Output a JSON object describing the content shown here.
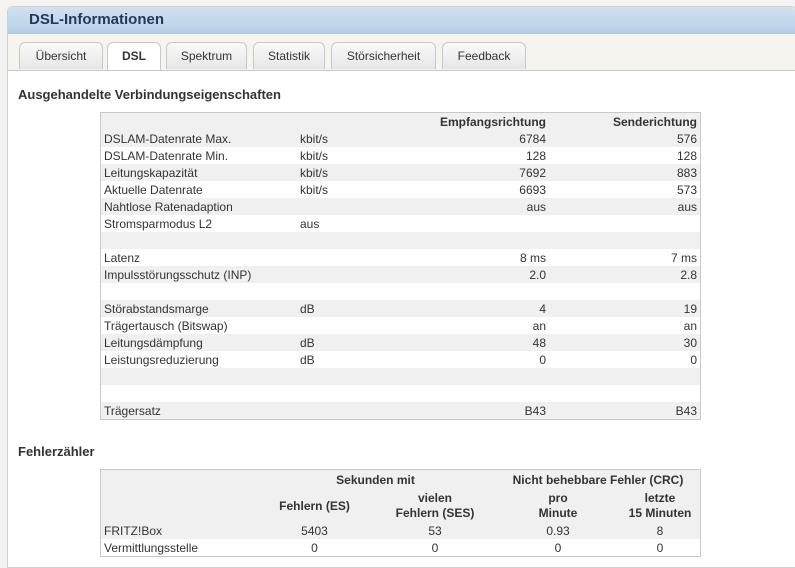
{
  "title": "DSL-Informationen",
  "tabs": [
    "Übersicht",
    "DSL",
    "Spektrum",
    "Statistik",
    "Störsicherheit",
    "Feedback"
  ],
  "active_tab": "DSL",
  "section1": {
    "heading": "Ausgehandelte Verbindungseigenschaften",
    "col_down": "Empfangsrichtung",
    "col_up": "Senderichtung",
    "rows": [
      {
        "label": "DSLAM-Datenrate Max.",
        "unit": "kbit/s",
        "down": "6784",
        "up": "576"
      },
      {
        "label": "DSLAM-Datenrate Min.",
        "unit": "kbit/s",
        "down": "128",
        "up": "128"
      },
      {
        "label": "Leitungskapazität",
        "unit": "kbit/s",
        "down": "7692",
        "up": "883"
      },
      {
        "label": "Aktuelle Datenrate",
        "unit": "kbit/s",
        "down": "6693",
        "up": "573"
      },
      {
        "label": "Nahtlose Ratenadaption",
        "unit": "",
        "down": "aus",
        "up": "aus"
      },
      {
        "label": "Stromsparmodus L2",
        "unit": "aus",
        "down": "",
        "up": ""
      },
      {
        "label": "",
        "unit": "",
        "down": "",
        "up": ""
      },
      {
        "label": "Latenz",
        "unit": "",
        "down": "8 ms",
        "up": "7 ms"
      },
      {
        "label": "Impulsstörungsschutz (INP)",
        "unit": "",
        "down": "2.0",
        "up": "2.8"
      },
      {
        "label": "",
        "unit": "",
        "down": "",
        "up": ""
      },
      {
        "label": "Störabstandsmarge",
        "unit": "dB",
        "down": "4",
        "up": "19"
      },
      {
        "label": "Trägertausch (Bitswap)",
        "unit": "",
        "down": "an",
        "up": "an"
      },
      {
        "label": "Leitungsdämpfung",
        "unit": "dB",
        "down": "48",
        "up": "30"
      },
      {
        "label": "Leistungsreduzierung",
        "unit": "dB",
        "down": "0",
        "up": "0"
      },
      {
        "label": "",
        "unit": "",
        "down": "",
        "up": ""
      },
      {
        "label": "",
        "unit": "",
        "down": "",
        "up": ""
      },
      {
        "label": "Trägersatz",
        "unit": "",
        "down": "B43",
        "up": "B43"
      }
    ]
  },
  "section2": {
    "heading": "Fehlerzähler",
    "group1": "Sekunden mit",
    "group2": "Nicht behebbare Fehler (CRC)",
    "c1": "Fehlern (ES)",
    "c2a": "vielen",
    "c2b": "Fehlern (SES)",
    "c3a": "pro",
    "c3b": "Minute",
    "c4a": "letzte",
    "c4b": "15 Minuten",
    "rows": [
      {
        "label": "FRITZ!Box",
        "es": "5403",
        "ses": "53",
        "per_min": "0.93",
        "last15": "8"
      },
      {
        "label": "Vermittlungsstelle",
        "es": "0",
        "ses": "0",
        "per_min": "0",
        "last15": "0"
      }
    ]
  }
}
